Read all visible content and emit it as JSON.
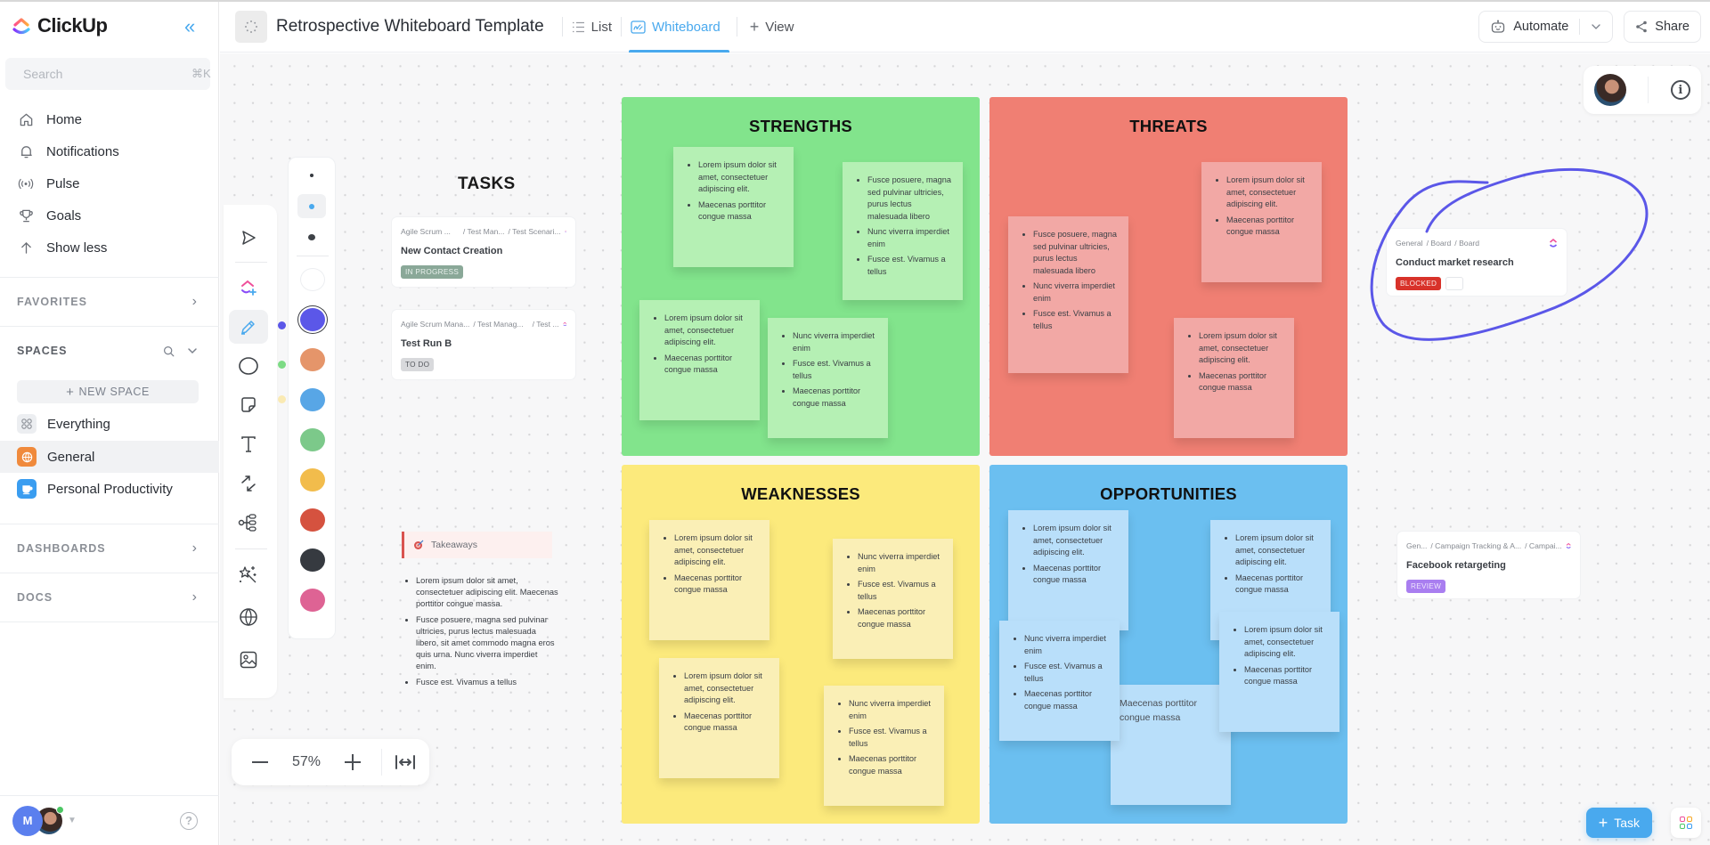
{
  "app": {
    "name": "ClickUp",
    "search_placeholder": "Search",
    "search_shortcut": "⌘K"
  },
  "sidebar": {
    "nav": [
      {
        "label": "Home",
        "icon": "home-icon"
      },
      {
        "label": "Notifications",
        "icon": "bell-icon"
      },
      {
        "label": "Pulse",
        "icon": "pulse-icon"
      },
      {
        "label": "Goals",
        "icon": "trophy-icon"
      },
      {
        "label": "Show less",
        "icon": "arrow-up-icon"
      }
    ],
    "favorites_label": "FAVORITES",
    "spaces_label": "SPACES",
    "new_space_label": "NEW SPACE",
    "spaces": [
      {
        "label": "Everything",
        "color": "#e8e9ec"
      },
      {
        "label": "General",
        "color": "#f08a3c",
        "active": true
      },
      {
        "label": "Personal Productivity",
        "color": "#3a9df0"
      }
    ],
    "dashboards_label": "DASHBOARDS",
    "docs_label": "DOCS",
    "user_initial": "M"
  },
  "header": {
    "title": "Retrospective Whiteboard Template",
    "tabs": [
      {
        "label": "List",
        "active": false
      },
      {
        "label": "Whiteboard",
        "active": true
      }
    ],
    "add_view_label": "View",
    "automate_label": "Automate",
    "share_label": "Share"
  },
  "toolbar": {
    "tools": [
      "select",
      "clickup-add",
      "pen",
      "shape",
      "sticky-note",
      "text",
      "connector",
      "mindmap",
      "ai-magic",
      "web-embed",
      "image"
    ],
    "active_tool": "pen",
    "stroke_sizes": [
      "small",
      "medium",
      "large"
    ],
    "active_stroke": "medium",
    "colors": [
      "#ffffff",
      "#5b57e8",
      "#e5956a",
      "#58a6e6",
      "#7cc98a",
      "#f2bc4c",
      "#d5523f",
      "#363a40",
      "#de6394"
    ],
    "selected_color": "#5b57e8"
  },
  "zoom": {
    "value": "57%"
  },
  "tasks_section": {
    "title": "TASKS",
    "cards": [
      {
        "crumbs": [
          "Agile Scrum ...",
          "/ Test Man...",
          "/ Test Scenari..."
        ],
        "title": "New Contact Creation",
        "status": "IN PROGRESS",
        "status_bg": "#8aa898",
        "status_fg": "#e8f0ec"
      },
      {
        "crumbs": [
          "Agile Scrum Mana...",
          "/ Test Manag...",
          "/ Test ..."
        ],
        "title": "Test Run B",
        "status": "TO DO",
        "status_bg": "#d8d9dc",
        "status_fg": "#55585e"
      }
    ]
  },
  "takeaways": {
    "label": "Takeaways",
    "items": [
      "Lorem ipsum dolor sit amet, consectetuer adipiscing elit. Maecenas porttitor congue massa.",
      "Fusce posuere, magna sed pulvinar ultricies, purus lectus malesuada libero, sit amet commodo magna eros quis urna. Nunc viverra imperdiet enim.",
      "Fusce est. Vivamus a tellus"
    ]
  },
  "quadrants": [
    {
      "title": "STRENGTHS",
      "bg": "#82e48c",
      "sticky_bg": "#b5f0b4",
      "stickies": [
        {
          "items": [
            "Lorem ipsum dolor sit amet, consectetuer adipiscing elit.",
            "Maecenas porttitor congue massa"
          ]
        },
        {
          "items": [
            "Fusce posuere, magna sed pulvinar ultricies, purus lectus malesuada libero",
            "Nunc viverra imperdiet enim",
            "Fusce est. Vivamus a tellus"
          ]
        },
        {
          "items": [
            "Lorem ipsum dolor sit amet, consectetuer adipiscing elit.",
            "Maecenas porttitor congue massa"
          ]
        },
        {
          "items": [
            "Nunc viverra imperdiet enim",
            "Fusce est. Vivamus a tellus",
            "Maecenas porttitor congue massa"
          ]
        }
      ]
    },
    {
      "title": "THREATS",
      "bg": "#f07f73",
      "sticky_bg": "#f2a8a5",
      "stickies": [
        {
          "items": [
            "Fusce posuere, magna sed pulvinar ultricies, purus lectus malesuada libero",
            "Nunc viverra imperdiet enim",
            "Fusce est. Vivamus a tellus"
          ]
        },
        {
          "items": [
            "Lorem ipsum dolor sit amet, consectetuer adipiscing elit.",
            "Maecenas porttitor congue massa"
          ]
        },
        {
          "items": [
            "Lorem ipsum dolor sit amet, consectetuer adipiscing elit.",
            "Maecenas porttitor congue massa"
          ]
        }
      ]
    },
    {
      "title": "WEAKNESSES",
      "bg": "#fcea7c",
      "sticky_bg": "#faefb6",
      "stickies": [
        {
          "items": [
            "Lorem ipsum dolor sit amet, consectetuer adipiscing elit.",
            "Maecenas porttitor congue massa"
          ]
        },
        {
          "items": [
            "Nunc viverra imperdiet enim",
            "Fusce est. Vivamus a tellus",
            "Maecenas porttitor congue massa"
          ]
        },
        {
          "items": [
            "Lorem ipsum dolor sit amet, consectetuer adipiscing elit.",
            "Maecenas porttitor congue massa"
          ]
        },
        {
          "items": [
            "Nunc viverra imperdiet enim",
            "Fusce est. Vivamus a tellus",
            "Maecenas porttitor congue massa"
          ]
        }
      ]
    },
    {
      "title": "OPPORTUNITIES",
      "bg": "#6bbff0",
      "sticky_bg": "#b9dffa",
      "stickies": [
        {
          "items": [
            "Lorem ipsum dolor sit amet, consectetuer adipiscing elit.",
            "Maecenas porttitor congue massa"
          ]
        },
        {
          "items": [
            "Lorem ipsum dolor sit amet, consectetuer adipiscing elit.",
            "Maecenas porttitor congue massa"
          ]
        },
        {
          "text": "Maecenas porttitor congue massa"
        },
        {
          "items": [
            "Nunc viverra imperdiet enim",
            "Fusce est. Vivamus a tellus",
            "Maecenas porttitor congue massa"
          ]
        },
        {
          "items": [
            "Lorem ipsum dolor sit amet, consectetuer adipiscing elit.",
            "Maecenas porttitor congue massa"
          ]
        }
      ]
    }
  ],
  "side_cards": [
    {
      "crumbs": [
        "General",
        "/ Board",
        "/ Board"
      ],
      "title": "Conduct market research",
      "status": "BLOCKED",
      "status_bg": "#d8322a",
      "status_fg": "#fde8e6",
      "annotation": "pen-circle",
      "annotation_color": "#5b57e8"
    },
    {
      "crumbs": [
        "Gen...",
        "/ Campaign Tracking & A...",
        "/ Campai..."
      ],
      "title": "Facebook retargeting",
      "status": "REVIEW",
      "status_bg": "#a97ef0",
      "status_fg": "#efe6fd"
    }
  ],
  "fab": {
    "task_label": "Task"
  }
}
